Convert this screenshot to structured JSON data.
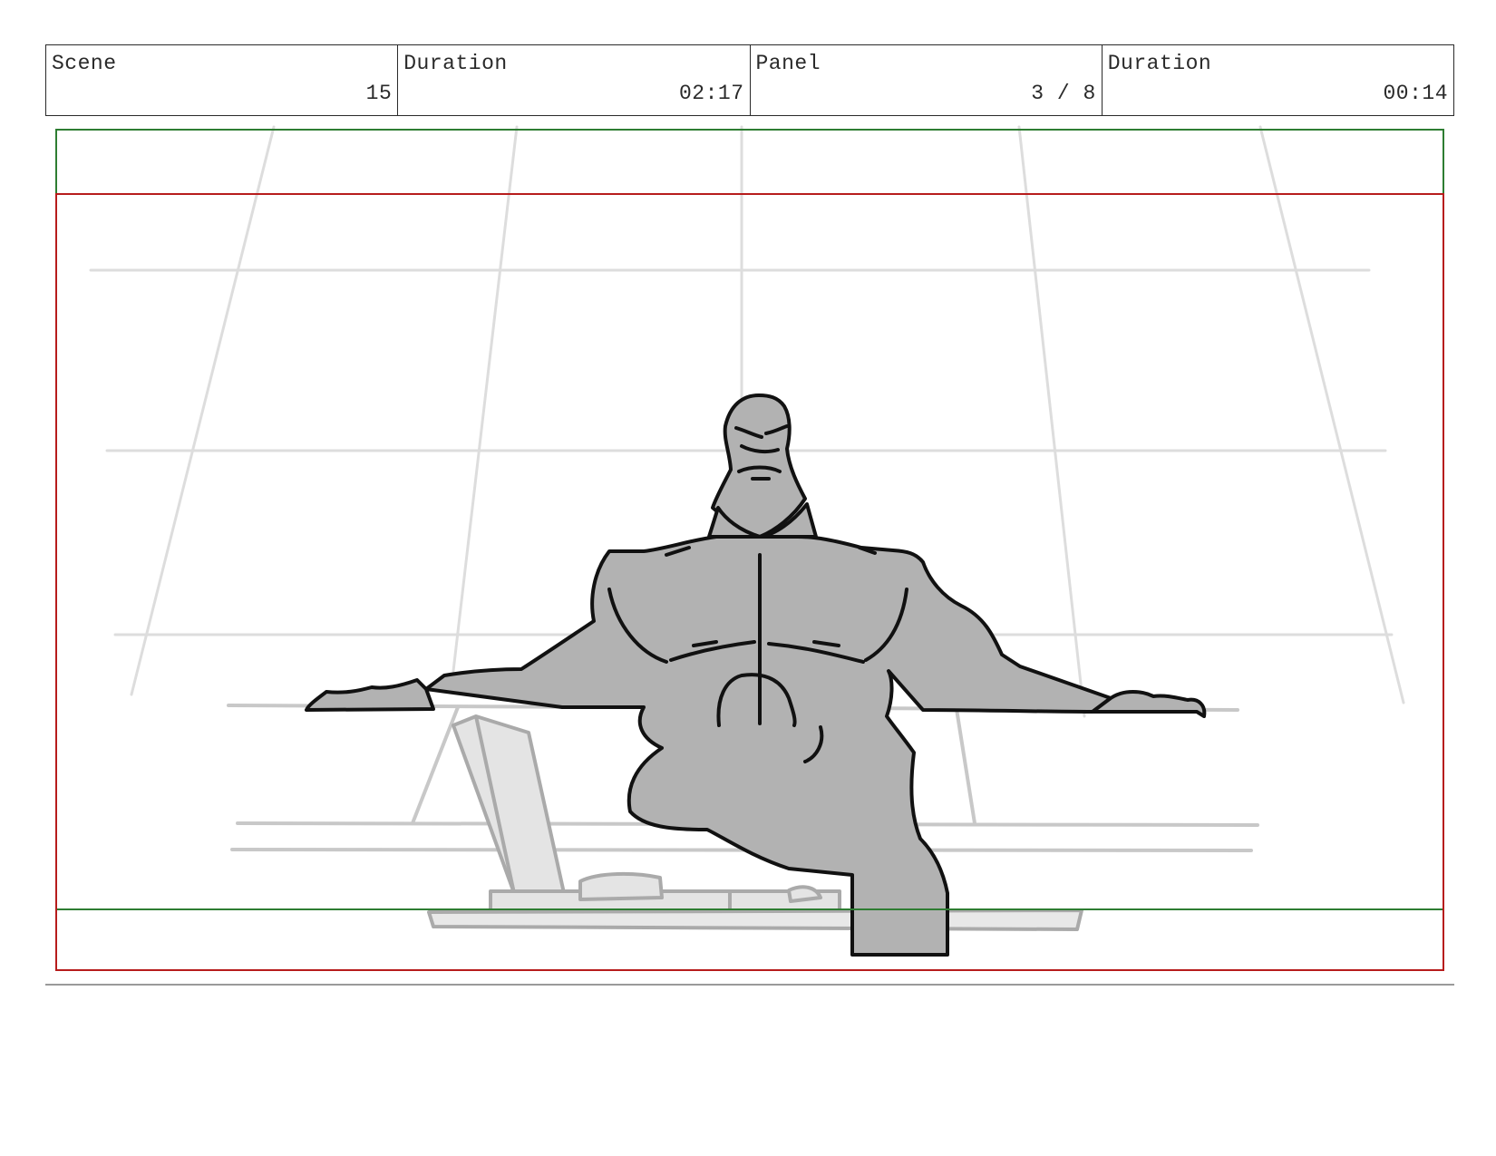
{
  "header": {
    "scene": {
      "label": "Scene",
      "value": "15"
    },
    "scene_duration": {
      "label": "Duration",
      "value": "02:17"
    },
    "panel": {
      "label": "Panel",
      "value": "3 / 8"
    },
    "panel_duration": {
      "label": "Duration",
      "value": "00:14"
    }
  },
  "colors": {
    "header_border": "#2a2a2a",
    "safe_frame": "#2e7d32",
    "action_frame": "#b71c1c",
    "figure_fill": "#b2b2b2",
    "figure_line": "#111111",
    "background_lines": "#dcdcdc",
    "props_fill": "#e4e4e4",
    "props_line": "#aaaaaa"
  },
  "drawing": {
    "subject": "muscular-figure-seated-icon",
    "props": [
      "laptop-icon",
      "desk-icon"
    ]
  }
}
